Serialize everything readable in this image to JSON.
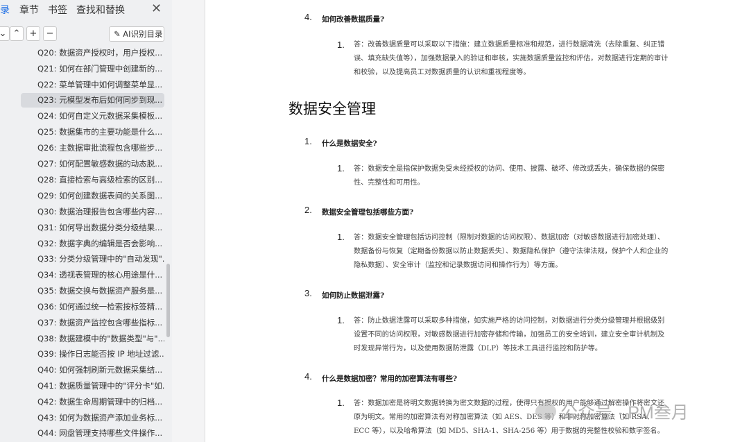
{
  "sidebar": {
    "tabs": [
      "录",
      "章节",
      "书签",
      "查找和替换"
    ],
    "close_icon": "close-icon",
    "toolbar": {
      "collapse_icon": "chevron-down-icon",
      "up_icon": "chevron-up-icon",
      "add_icon": "plus-icon",
      "remove_icon": "minus-icon",
      "ai_label": "AI识别目录"
    },
    "toc_items": [
      "Q20: 数据资产授权时，用户授权...",
      "Q21: 如何在部门管理中创建新的...",
      "Q22: 菜单管理中如何调整菜单显...",
      "Q23: 元模型发布后如何同步到现...",
      "Q24: 如何自定义元数据采集模板...",
      "Q25: 数据集市的主要功能是什么...",
      "Q26: 主数据审批流程包含哪些步...",
      "Q27: 如何配置敏感数据的动态脱...",
      "Q28: 直接检索与高级检索的区别...",
      "Q29: 如何创建数据表间的关系图...",
      "Q30: 数据治理报告包含哪些内容...",
      "Q31: 如何导出数据分类分级结果...",
      "Q32: 数据字典的编辑是否会影响...",
      "Q33: 分类分级管理中的\"自动发现\"...",
      "Q34: 透视表管理的核心用途是什...",
      "Q35: 数据交换与数据资产服务是...",
      "Q36: 如何通过统一检索按标签精...",
      "Q37: 数据资产监控包含哪些指标...",
      "Q38: 数据建模中的\"数据类型\"与\"...",
      "Q39: 操作日志能否按 IP 地址过滤...",
      "Q40: 如何强制刷新元数据采集结...",
      "Q41: 数据质量管理中的\"评分卡\"如...",
      "Q42: 数据生命周期管理中的归档...",
      "Q43: 如何为数据资产添加业务标...",
      "Q44: 网盘管理支持哪些文件操作..."
    ],
    "selected_index": 3
  },
  "document": {
    "top_question": {
      "num": "4.",
      "text": "如何改善数据质量?"
    },
    "top_answer": {
      "num": "1.",
      "text": "答：改善数据质量可以采取以下措施：建立数据质量标准和规范，进行数据清洗（去除重复、纠正错误、填充缺失值等），加强数据录入的验证和审核，实施数据质量监控和评估，对数据进行定期的审计和校验，以及提高员工对数据质量的认识和重视程度等。"
    },
    "section_title": "数据安全管理",
    "questions": [
      {
        "num": "1.",
        "text": "什么是数据安全?",
        "answer_num": "1.",
        "answer": "答：数据安全是指保护数据免受未经授权的访问、使用、披露、破坏、修改或丢失，确保数据的保密性、完整性和可用性。"
      },
      {
        "num": "2.",
        "text": "数据安全管理包括哪些方面?",
        "answer_num": "1.",
        "answer": "答：数据安全管理包括访问控制（限制对数据的访问权限）、数据加密（对敏感数据进行加密处理）、数据备份与恢复（定期备份数据以防止数据丢失）、数据隐私保护（遵守法律法规，保护个人和企业的隐私数据）、安全审计（监控和记录数据访问和操作行为）等方面。"
      },
      {
        "num": "3.",
        "text": "如何防止数据泄露?",
        "answer_num": "1.",
        "answer": "答：防止数据泄露可以采取多种措施，如实施严格的访问控制，对数据进行分类分级管理并根据级别设置不同的访问权限，对敏感数据进行加密存储和传输，加强员工的安全培训，建立安全审计机制及时发现异常行为，以及使用数据防泄露（DLP）等技术工具进行监控和防护等。"
      },
      {
        "num": "4.",
        "text": "什么是数据加密？常用的加密算法有哪些?",
        "answer_num": "1.",
        "answer": "答：数据加密是将明文数据转换为密文数据的过程，使得只有授权的用户能够通过解密操作将密文还原为明文。常用的加密算法有对称加密算法（如 AES、DES 等）和非对称加密算法（如 RSA、ECC 等），以及哈希算法（如 MD5、SHA-1、SHA-256 等）用于数据的完整性校验和数字签名。"
      }
    ],
    "watermark": "公众号 · PM叁月"
  }
}
